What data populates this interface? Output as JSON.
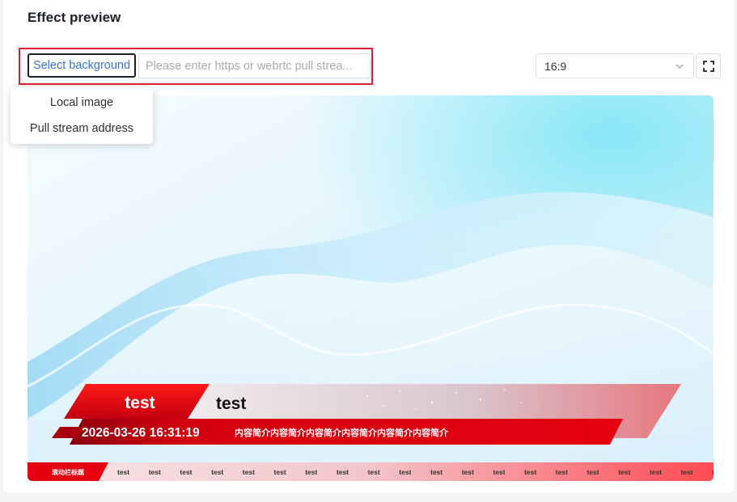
{
  "header": {
    "title": "Effect preview"
  },
  "toolbar": {
    "select_background_label": "Select background",
    "url_placeholder": "Please enter https or webrtc pull strea...",
    "url_value": "",
    "aspect_ratio": "16:9",
    "fullscreen_icon": "fullscreen-icon"
  },
  "dropdown": {
    "items": [
      {
        "label": "Local image"
      },
      {
        "label": "Pull stream address"
      }
    ]
  },
  "preview": {
    "lower_third": {
      "name_left": "test",
      "name_right": "test",
      "datetime": "2026-03-26 16:31:19",
      "intro": "内容简介内容简介内容简介内容简介内容简介内容简介"
    },
    "ticker": {
      "label": "滚动栏标题",
      "items": [
        "test",
        "test",
        "test",
        "test",
        "test",
        "test",
        "test",
        "test",
        "test",
        "test",
        "test",
        "test",
        "test",
        "test",
        "test",
        "test",
        "test",
        "test",
        "test",
        "test"
      ]
    }
  },
  "colors": {
    "accent_red": "#e4000f",
    "select_text": "#3a72d8",
    "highlight_border": "#d9202e"
  }
}
